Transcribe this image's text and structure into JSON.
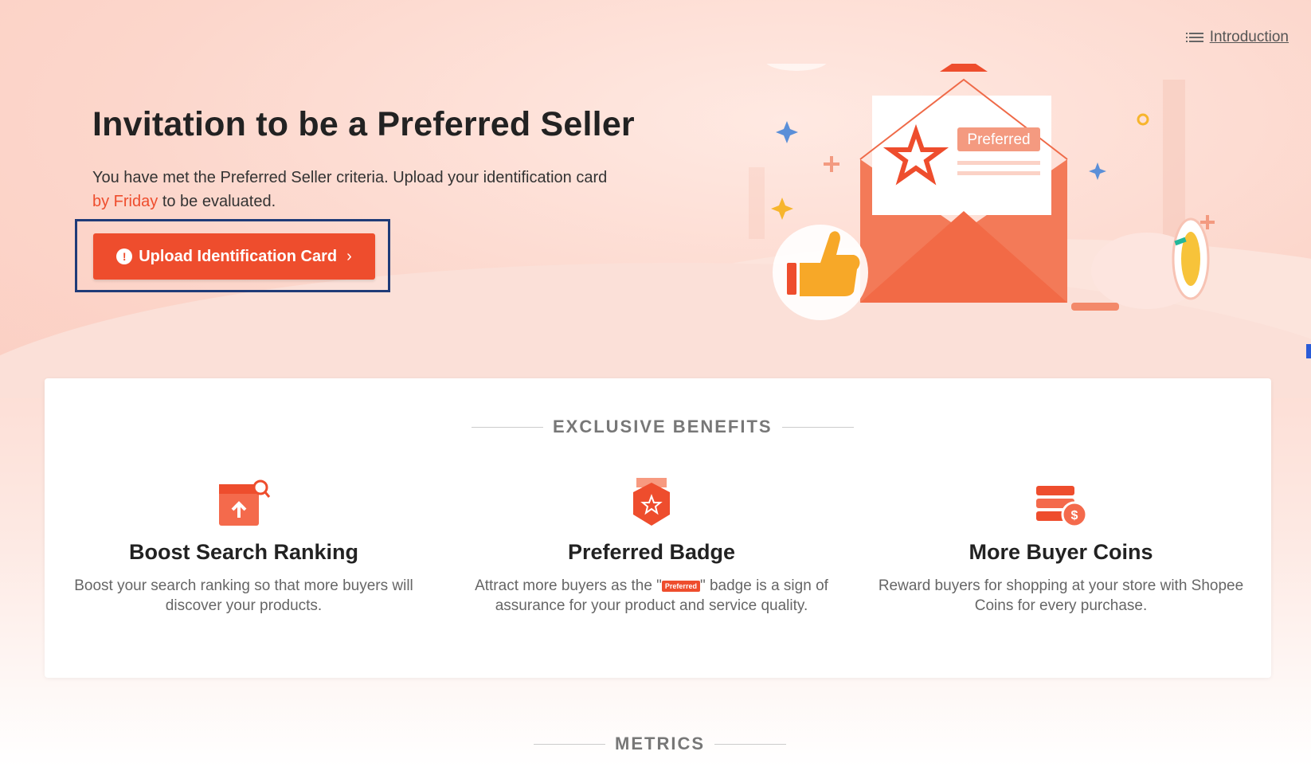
{
  "header": {
    "intro_link": "Introduction"
  },
  "hero": {
    "title": "Invitation to be a Preferred Seller",
    "subtitle_part1": "You have met the Preferred Seller criteria. Upload your identification card",
    "subtitle_highlight": "by Friday",
    "subtitle_part2": "to be evaluated.",
    "upload_button_label": "Upload Identification Card",
    "illustration_label": "Preferred"
  },
  "benefits": {
    "section_title": "EXCLUSIVE BENEFITS",
    "items": [
      {
        "title": "Boost Search Ranking",
        "desc": "Boost your search ranking so that more buyers will discover your products.",
        "icon": "search-ranking-icon"
      },
      {
        "title": "Preferred Badge",
        "desc_part1": "Attract more buyers as the \"",
        "badge_text": "Preferred",
        "desc_part2": "\" badge is a sign of assurance for your product and service quality.",
        "icon": "badge-icon"
      },
      {
        "title": "More Buyer Coins",
        "desc": "Reward buyers for shopping at your store with Shopee Coins for every purchase.",
        "icon": "coins-icon"
      }
    ]
  },
  "metrics": {
    "section_title": "METRICS"
  },
  "colors": {
    "accent": "#ee4d2d",
    "focus_frame": "#1f3b78"
  }
}
